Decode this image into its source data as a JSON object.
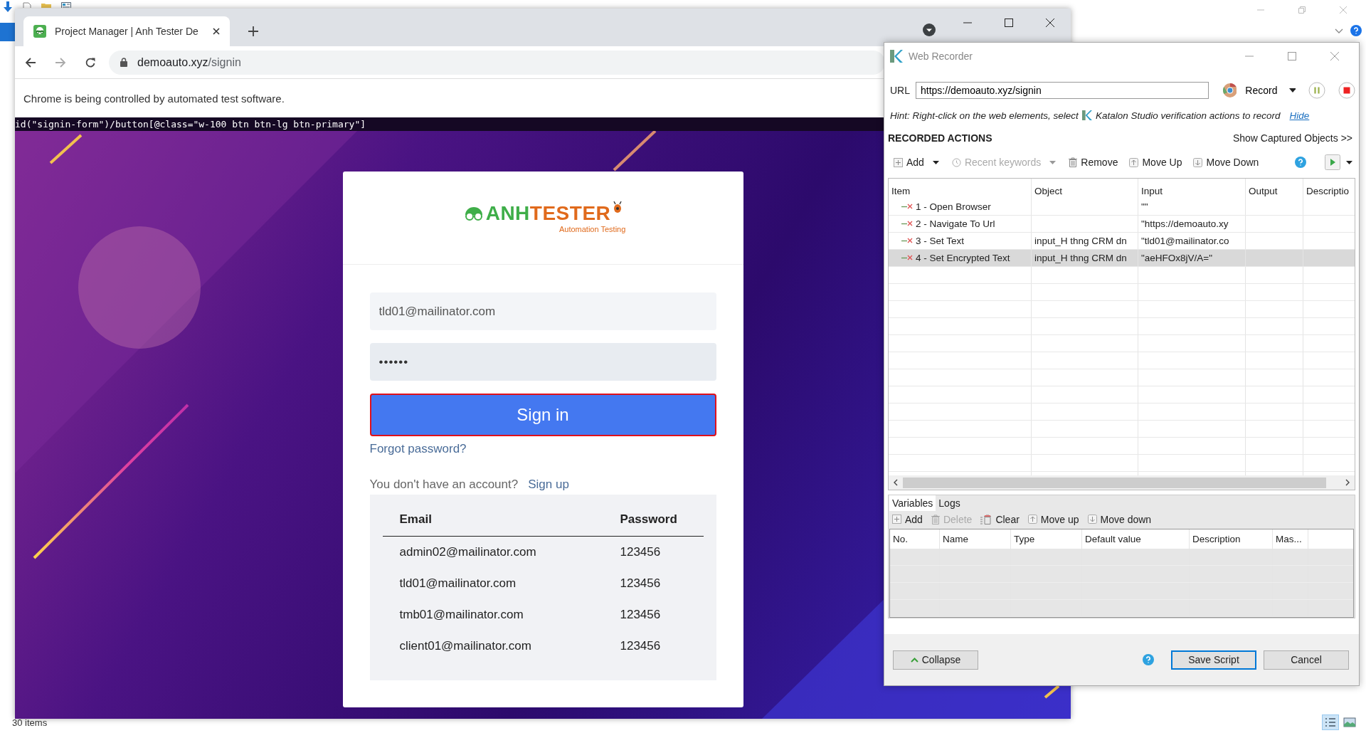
{
  "desktop": {
    "status": "30 items"
  },
  "browser": {
    "tabs": [
      {
        "title": "Project Manager | Anh Tester De",
        "selected": true
      }
    ],
    "address": {
      "host": "demoauto.xyz",
      "path": "/signin"
    },
    "infobar": "Chrome is being controlled by automated test software.",
    "xpath": "id(\"signin-form\")/button[@class=\"w-100 btn btn-lg btn-primary\"]"
  },
  "login": {
    "logo": {
      "word_1": "ANH",
      "word_2": "TESTER",
      "tagline": "Automation Testing"
    },
    "fields": [
      {
        "kind": "text",
        "value": "tld01@mailinator.com"
      },
      {
        "kind": "password",
        "value": "••••••"
      }
    ],
    "signin": {
      "label": "Sign in",
      "highlighted": true
    },
    "forgot": "Forgot password?",
    "signup_prompt": "You don't have an account?",
    "signup_link": "Sign up",
    "accounts": {
      "columns": [
        "Email",
        "Password"
      ],
      "rows": [
        [
          "admin02@mailinator.com",
          "123456"
        ],
        [
          "tld01@mailinator.com",
          "123456"
        ],
        [
          "tmb01@mailinator.com",
          "123456"
        ],
        [
          "client01@mailinator.com",
          "123456"
        ]
      ]
    }
  },
  "recorder": {
    "title": "Web Recorder",
    "url_label": "URL",
    "url": "https://demoauto.xyz/signin",
    "record": "Record",
    "hint": {
      "before": "Hint: Right-click on the web elements, select",
      "after": "Katalon Studio verification actions to record",
      "link": "Hide"
    },
    "section": "RECORDED ACTIONS",
    "show_objects": "Show Captured Objects >>",
    "toolbar": [
      {
        "kind": "add",
        "label": "Add",
        "disabled": false,
        "dropdown": true
      },
      {
        "kind": "recent",
        "label": "Recent keywords",
        "disabled": true,
        "dropdown": true
      },
      {
        "kind": "remove",
        "label": "Remove",
        "disabled": false,
        "dropdown": false
      },
      {
        "kind": "up",
        "label": "Move Up",
        "disabled": false,
        "dropdown": false
      },
      {
        "kind": "down",
        "label": "Move Down",
        "disabled": false,
        "dropdown": false
      }
    ],
    "columns": [
      "Item",
      "Object",
      "Input",
      "Output",
      "Descriptio"
    ],
    "steps": [
      {
        "item": "1 - Open Browser",
        "input": "\"\"",
        "selected": false
      },
      {
        "item": "2 - Navigate To Url",
        "input": "\"https://demoauto.xy",
        "selected": false
      },
      {
        "item": "3 - Set Text",
        "object": "input_H thng CRM dn",
        "input": "\"tld01@mailinator.co",
        "selected": false
      },
      {
        "item": "4 - Set Encrypted Text",
        "object": "input_H thng CRM dn",
        "input": "\"aeHFOx8jV/A=\"",
        "selected": true
      }
    ],
    "bottom_tabs": [
      {
        "label": "Variables",
        "selected": true
      },
      {
        "label": "Logs",
        "selected": false
      }
    ],
    "var_toolbar": [
      {
        "kind": "add",
        "label": "Add",
        "disabled": false
      },
      {
        "kind": "delete",
        "label": "Delete",
        "disabled": true
      },
      {
        "kind": "clear",
        "label": "Clear",
        "disabled": false
      },
      {
        "kind": "up",
        "label": "Move up",
        "disabled": false
      },
      {
        "kind": "down",
        "label": "Move down",
        "disabled": false
      }
    ],
    "var_columns": [
      "No.",
      "Name",
      "Type",
      "Default value",
      "Description",
      "Mas..."
    ],
    "buttons": [
      {
        "kind": "collapse",
        "label": "Collapse",
        "default": false
      },
      {
        "kind": "save",
        "label": "Save Script",
        "default": true
      },
      {
        "kind": "cancel",
        "label": "Cancel",
        "default": false
      }
    ]
  }
}
